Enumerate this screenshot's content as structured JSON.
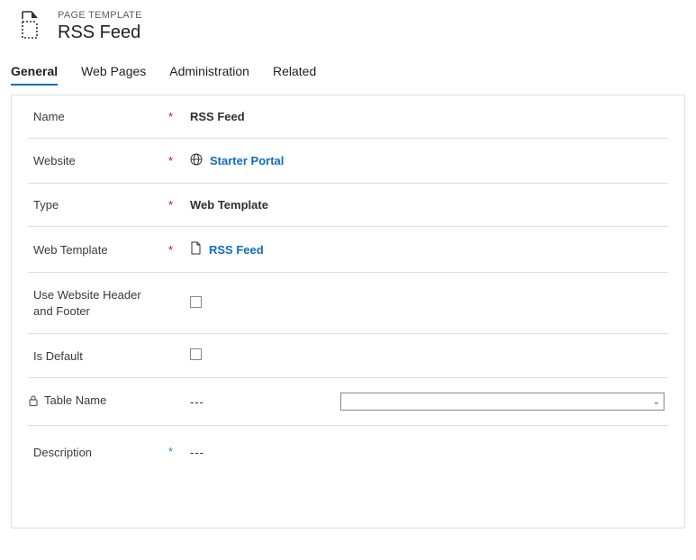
{
  "header": {
    "eyebrow": "PAGE TEMPLATE",
    "title": "RSS Feed"
  },
  "tabs": [
    {
      "label": "General",
      "active": true
    },
    {
      "label": "Web Pages",
      "active": false
    },
    {
      "label": "Administration",
      "active": false
    },
    {
      "label": "Related",
      "active": false
    }
  ],
  "form": {
    "name": {
      "label": "Name",
      "required": true,
      "value": "RSS Feed"
    },
    "website": {
      "label": "Website",
      "required": true,
      "value": "Starter Portal"
    },
    "type": {
      "label": "Type",
      "required": true,
      "value": "Web Template"
    },
    "webTemplate": {
      "label": "Web Template",
      "required": true,
      "value": "RSS Feed"
    },
    "useHeaderFooter": {
      "label_line1": "Use Website Header",
      "label_line2": "and Footer",
      "checked": false
    },
    "isDefault": {
      "label": "Is Default",
      "checked": false
    },
    "tableName": {
      "label": "Table Name",
      "value": "---",
      "locked": true,
      "dropdownValue": ""
    },
    "description": {
      "label": "Description",
      "recommended": true,
      "value": "---"
    }
  }
}
